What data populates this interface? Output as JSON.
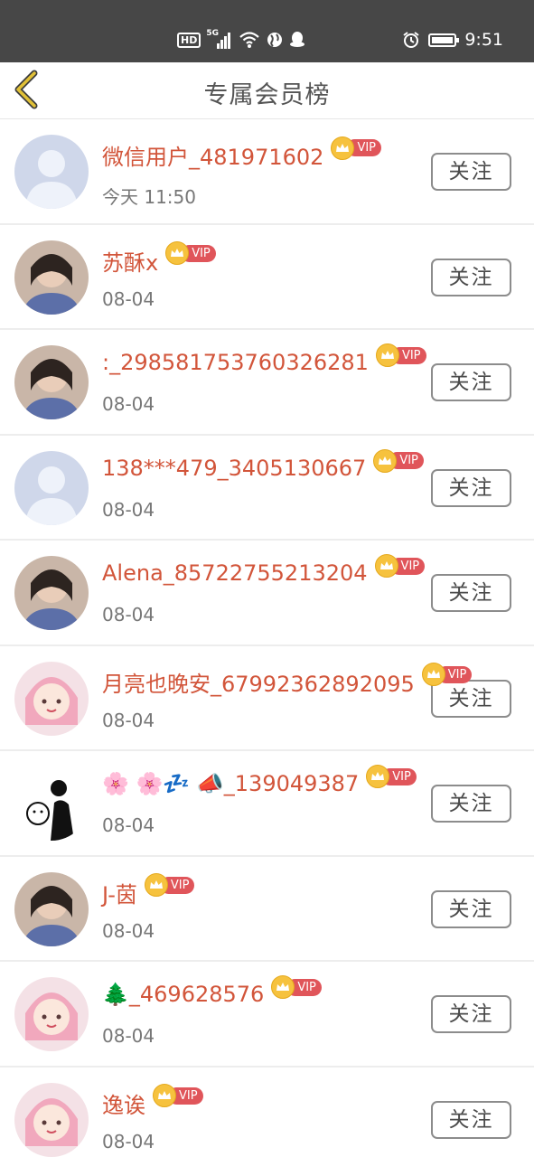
{
  "status_bar": {
    "network_badge": "HD",
    "signal_label": "5G",
    "time": "9:51"
  },
  "header": {
    "title": "专属会员榜"
  },
  "vip_label": "VIP",
  "follow_label": "关注",
  "members": [
    {
      "name": "微信用户_481971602",
      "time": "今天 11:50",
      "avatar": "default-avatar"
    },
    {
      "name": "苏酥x",
      "time": "08-04",
      "avatar": "photo-avatar"
    },
    {
      "name": ":_298581753760326281",
      "time": "08-04",
      "avatar": "photo-avatar"
    },
    {
      "name": "138***479_3405130667",
      "time": "08-04",
      "avatar": "default-avatar"
    },
    {
      "name": "Alena_85722755213204",
      "time": "08-04",
      "avatar": "photo-avatar"
    },
    {
      "name": "月亮也晚安_67992362892095",
      "time": "08-04",
      "avatar": "anime-avatar"
    },
    {
      "name": "🌸 🌸💤 📣_139049387",
      "time": "08-04",
      "avatar": "sketch-avatar"
    },
    {
      "name": "J-茵",
      "time": "08-04",
      "avatar": "photo-avatar"
    },
    {
      "name": "🌲_469628576",
      "time": "08-04",
      "avatar": "anime-avatar"
    },
    {
      "name": "逸诶",
      "time": "08-04",
      "avatar": "anime-avatar"
    }
  ],
  "colors": {
    "name_text": "#d2553a",
    "status_bar_bg": "#474747",
    "vip_pill": "#e0555a",
    "vip_crown": "#f6c23e",
    "back_arrow": "#e1c137"
  }
}
